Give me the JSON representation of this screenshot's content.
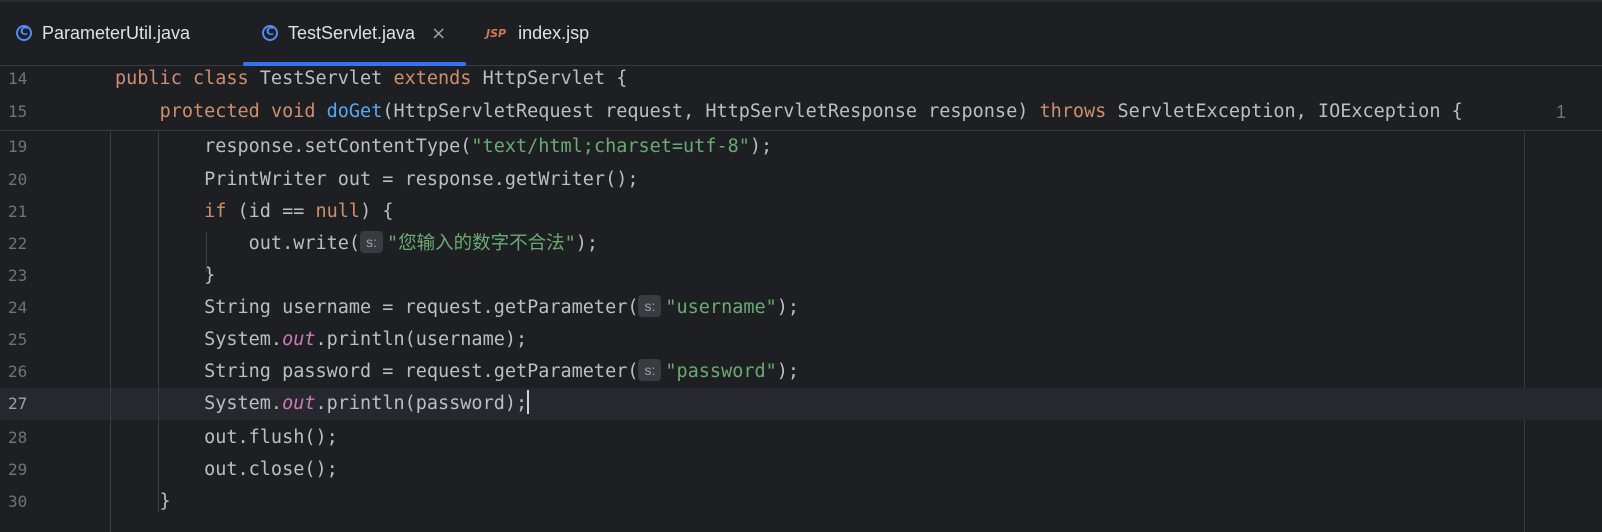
{
  "tabs": [
    {
      "label": "ParameterUtil.java",
      "icon": "class-icon",
      "active": false
    },
    {
      "label": "TestServlet.java",
      "icon": "class-icon",
      "active": true,
      "close": "×"
    },
    {
      "label": "index.jsp",
      "icon": "jsp-icon",
      "icon_text": "JSP",
      "active": false
    }
  ],
  "lines": [
    {
      "num": "14",
      "parts": [
        [
          "kw",
          "public class "
        ],
        [
          "",
          "TestServlet "
        ],
        [
          "kw",
          "extends "
        ],
        [
          "",
          "HttpServlet {"
        ]
      ]
    },
    {
      "num": "15",
      "parts": [
        [
          "",
          "    "
        ],
        [
          "kw",
          "protected void "
        ],
        [
          "fn",
          "doGet"
        ],
        [
          "",
          "(HttpServletRequest request, HttpServletResponse response) "
        ],
        [
          "kw",
          "throws "
        ],
        [
          "",
          "ServletException, IOException {"
        ]
      ]
    },
    {
      "num": "19",
      "parts": [
        [
          "",
          "        response.setContentType("
        ],
        [
          "str",
          "\"text/html;charset=utf-8\""
        ],
        [
          "",
          ");"
        ]
      ]
    },
    {
      "num": "20",
      "parts": [
        [
          "",
          "        PrintWriter out = response.getWriter();"
        ]
      ]
    },
    {
      "num": "21",
      "parts": [
        [
          "",
          "        "
        ],
        [
          "kw",
          "if "
        ],
        [
          "",
          "(id == "
        ],
        [
          "kw",
          "null"
        ],
        [
          "",
          ") {"
        ]
      ]
    },
    {
      "num": "22",
      "parts": [
        [
          "",
          "            out.write("
        ],
        [
          "hint",
          "s:"
        ],
        [
          "str",
          "\"您输入的数字不合法\""
        ],
        [
          "",
          ");"
        ]
      ]
    },
    {
      "num": "23",
      "parts": [
        [
          "",
          "        }"
        ]
      ]
    },
    {
      "num": "24",
      "parts": [
        [
          "",
          "        String username = request.getParameter("
        ],
        [
          "hint",
          "s:"
        ],
        [
          "str",
          "\"username\""
        ],
        [
          "",
          ");"
        ]
      ]
    },
    {
      "num": "25",
      "parts": [
        [
          "",
          "        System."
        ],
        [
          "fld",
          "out"
        ],
        [
          "",
          ".println(username);"
        ]
      ]
    },
    {
      "num": "26",
      "parts": [
        [
          "",
          "        String password = request.getParameter("
        ],
        [
          "hint",
          "s:"
        ],
        [
          "str",
          "\"password\""
        ],
        [
          "",
          ");"
        ]
      ]
    },
    {
      "num": "27",
      "current": true,
      "parts": [
        [
          "",
          "        System."
        ],
        [
          "fld",
          "out"
        ],
        [
          "",
          ".println(password);"
        ],
        [
          "caret",
          ""
        ]
      ]
    },
    {
      "num": "28",
      "parts": [
        [
          "",
          "        out.flush();"
        ]
      ]
    },
    {
      "num": "29",
      "parts": [
        [
          "",
          "        out.close();"
        ]
      ]
    },
    {
      "num": "30",
      "parts": [
        [
          "",
          "    }"
        ]
      ]
    }
  ],
  "line15_end_hint": "1",
  "colors": {
    "background": "#1e1f22",
    "keyword": "#cf8e6d",
    "function": "#56a8f5",
    "string": "#6aab73",
    "field": "#c77dbb",
    "accent": "#3574f0"
  }
}
